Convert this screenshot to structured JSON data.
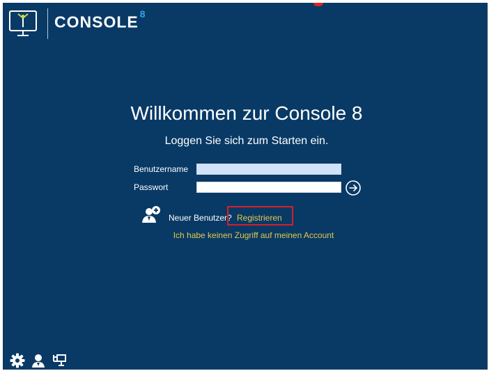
{
  "header": {
    "brand_name": "CONSOLE",
    "brand_version": "8"
  },
  "welcome": {
    "title": "Willkommen zur Console 8",
    "subtitle": "Loggen Sie sich zum Starten ein."
  },
  "login_form": {
    "username_label": "Benutzername",
    "username_value": "",
    "password_label": "Passwort",
    "password_value": ""
  },
  "registration": {
    "new_user_text": "Neuer Benutzer?",
    "register_label": "Registrieren",
    "no_access_label": "Ich habe keinen Zugriff auf meinen Account"
  },
  "colors": {
    "background": "#093a66",
    "link": "#e5c84b",
    "highlight_border": "#d71f26",
    "brand_accent": "#2da3f0"
  },
  "icons": {
    "logo": "monitor-tree-logo-icon",
    "submit": "arrow-right-circle-icon",
    "new_user": "add-user-icon",
    "settings": "gear-icon",
    "user": "user-icon",
    "network": "network-icon"
  }
}
